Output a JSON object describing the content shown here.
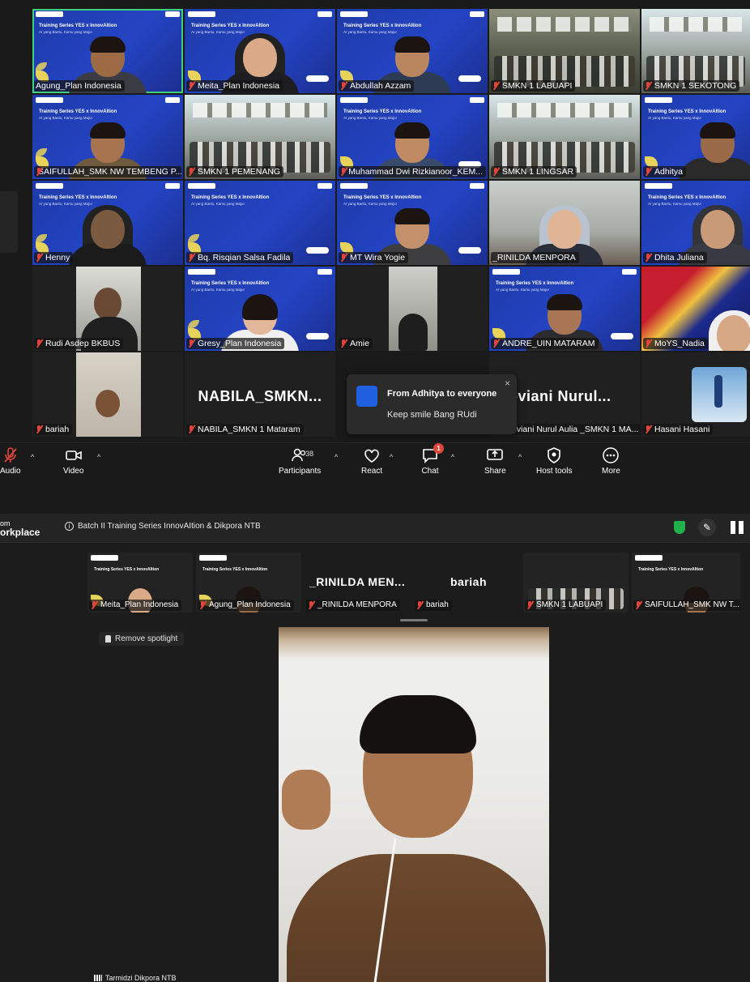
{
  "gallery": {
    "tiles": [
      {
        "name": "Agung_Plan Indonesia"
      },
      {
        "name": "Meita_Plan Indonesia"
      },
      {
        "name": "Abdullah Azzam"
      },
      {
        "name": "SMKN 1 LABUAPI"
      },
      {
        "name": "SMKN 1 SEKOTONG"
      },
      {
        "name": "SAIFULLAH_SMK NW TEMBENG P..."
      },
      {
        "name": "SMKN 1 PEMENANG"
      },
      {
        "name": "Muhammad Dwi Rizkianoor_KEM..."
      },
      {
        "name": "SMKN 1 LINGSAR"
      },
      {
        "name": "Adhitya"
      },
      {
        "name": "Henny"
      },
      {
        "name": "Bq. Risqian Salsa Fadila"
      },
      {
        "name": "MT Wira Yogie"
      },
      {
        "name": "_RINILDA MENPORA"
      },
      {
        "name": "Dhita Juliana"
      },
      {
        "name": "Rudi Asdep BKBUS"
      },
      {
        "name": "Gresy_Plan Indonesia"
      },
      {
        "name": "Amie"
      },
      {
        "name": "ANDRE_UIN MATARAM"
      },
      {
        "name": "MoYS_Nadia"
      },
      {
        "name": "bariah"
      },
      {
        "name": "NABILA_SMKN 1 Mataram",
        "big": "NABILA_SMKN..."
      },
      {
        "name": "oviani Nurul Aulia _SMKN 1 MA...",
        "big": "oviani  Nurul..."
      },
      {
        "name": "Hasani Hasani"
      }
    ],
    "banner": {
      "title": "Training Series YES x InnovAItion",
      "subtitle": "AI yang Bantu, Kamu yang Maju!"
    }
  },
  "chat_popup": {
    "from": "From Adhitya to everyone",
    "message": "Keep smile Bang RUdi",
    "close": "×"
  },
  "toolbar": {
    "audio": "Audio",
    "video": "Video",
    "participants": "Participants",
    "participants_count": "38",
    "react": "React",
    "chat": "Chat",
    "chat_badge": "1",
    "share": "Share",
    "host_tools": "Host tools",
    "more": "More"
  },
  "window": {
    "brand_top": "om",
    "brand_bottom": "orkplace",
    "meeting_title": "Batch II Training Series InnovAItion & Dikpora NTB",
    "info": "i"
  },
  "strip": [
    {
      "name": "Meita_Plan Indonesia"
    },
    {
      "name": "Agung_Plan Indonesia"
    },
    {
      "name": "_RINILDA MENPORA",
      "big": "_RINILDA  MEN..."
    },
    {
      "name": "bariah",
      "big": "bariah"
    },
    {
      "name": "SMKN 1 LABUAPI"
    },
    {
      "name": "SAIFULLAH_SMK NW T..."
    }
  ],
  "spotlight": {
    "remove_label": "Remove spotlight",
    "speaker_name": "Tarmidzi Dikpora NTB"
  },
  "icons": {
    "pen": "✎",
    "more": "⋯"
  }
}
